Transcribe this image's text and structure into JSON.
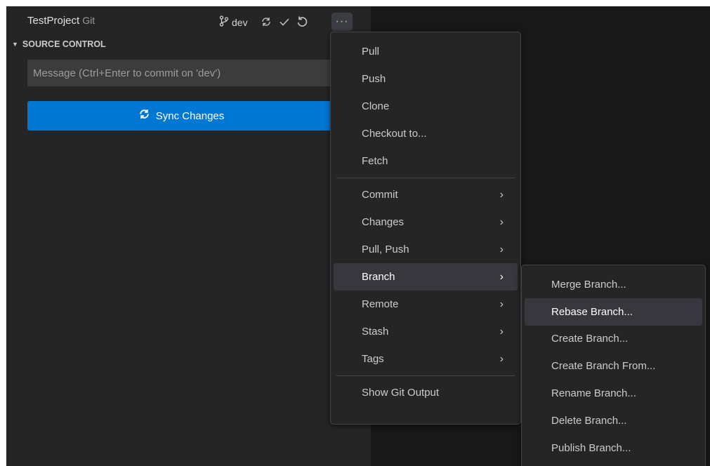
{
  "titlebar": {
    "repo_name": "TestProject",
    "provider": "Git",
    "branch": "dev",
    "branch_icon": "git-branch-icon",
    "actions": [
      "sync-icon",
      "check-icon",
      "undo-icon",
      "more-icon"
    ]
  },
  "section": {
    "title": "SOURCE CONTROL"
  },
  "commit": {
    "placeholder": "Message (Ctrl+Enter to commit on 'dev')",
    "sync_label": "Sync Changes"
  },
  "menu": {
    "group1": [
      "Pull",
      "Push",
      "Clone",
      "Checkout to...",
      "Fetch"
    ],
    "group2": [
      "Commit",
      "Changes",
      "Pull, Push",
      "Branch",
      "Remote",
      "Stash",
      "Tags"
    ],
    "group3": [
      "Show Git Output"
    ],
    "active_item": "Branch"
  },
  "submenu": {
    "items": [
      "Merge Branch...",
      "Rebase Branch...",
      "Create Branch...",
      "Create Branch From...",
      "Rename Branch...",
      "Delete Branch...",
      "Publish Branch..."
    ],
    "hovered_item": "Rebase Branch..."
  },
  "colors": {
    "panel_bg": "#252526",
    "accent": "#0078d4",
    "menu_active": "#37373d"
  }
}
